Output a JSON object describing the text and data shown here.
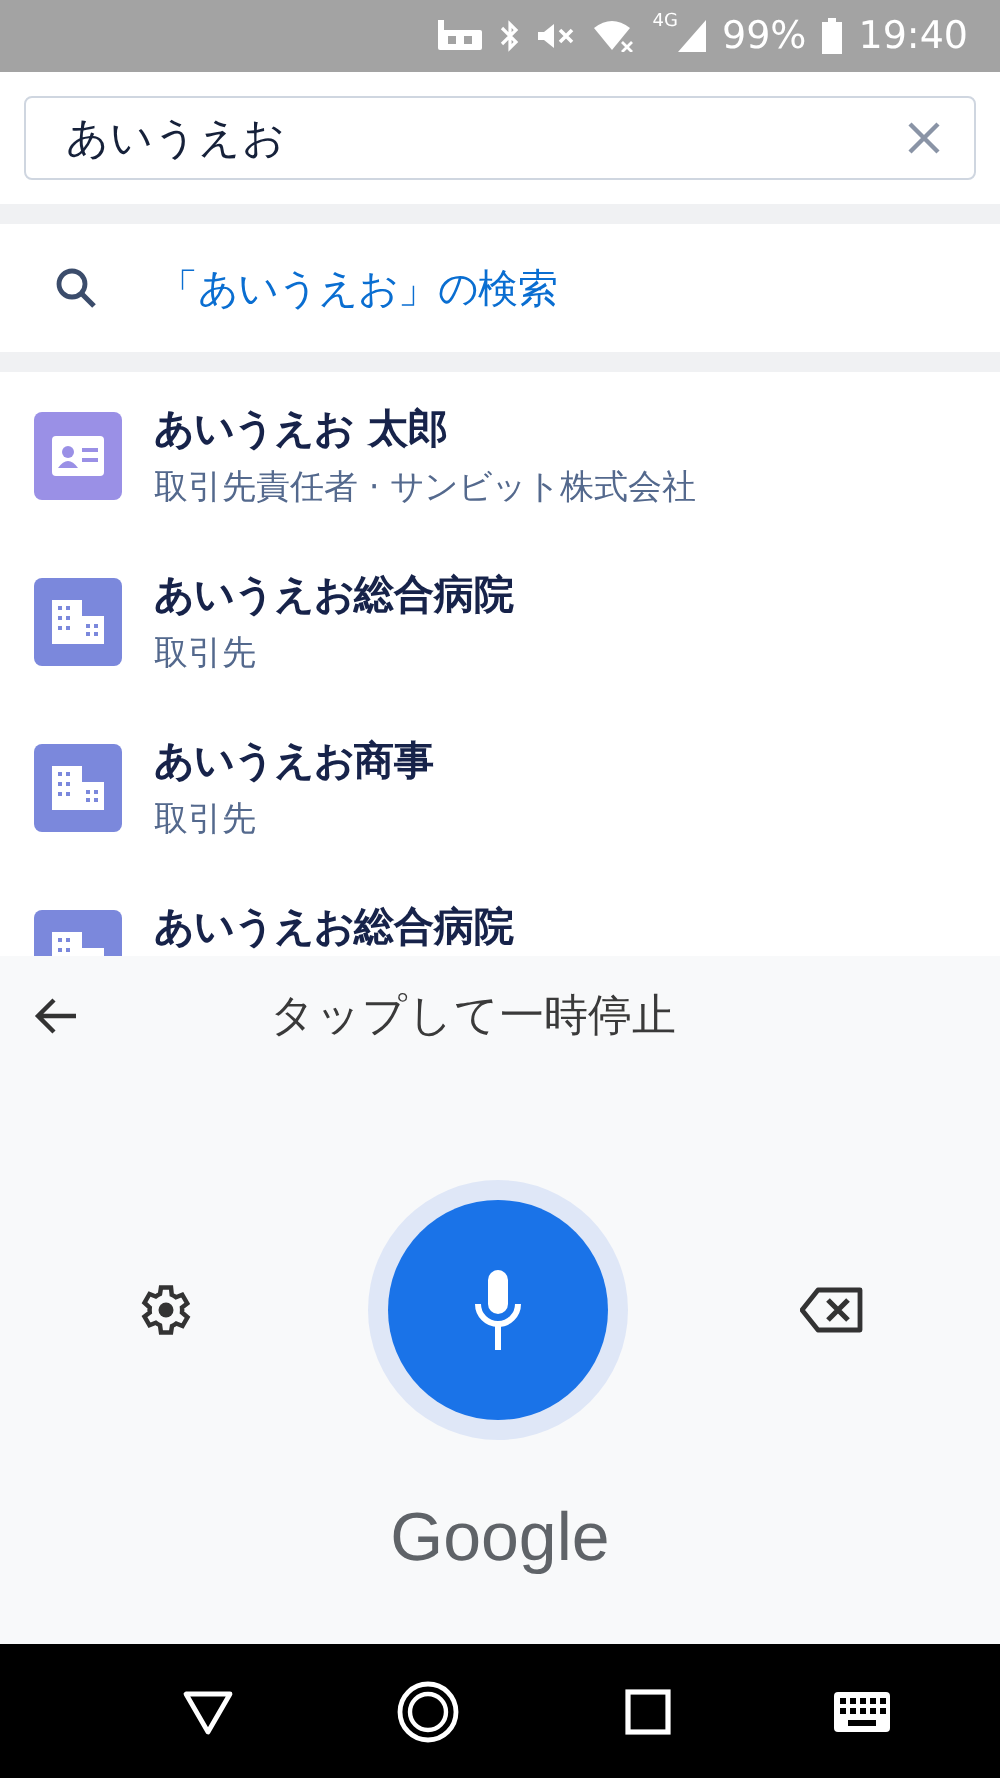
{
  "status_bar": {
    "network_label": "4G",
    "battery": "99%",
    "time": "19:40"
  },
  "search": {
    "value": "あいうえお"
  },
  "suggestion": {
    "text": "「あいうえお」の検索"
  },
  "results": [
    {
      "kind": "contact",
      "title": "あいうえお 太郎",
      "subtitle": "取引先責任者 · サンビット株式会社"
    },
    {
      "kind": "account",
      "title": "あいうえお総合病院",
      "subtitle": "取引先"
    },
    {
      "kind": "account",
      "title": "あいうえお商事",
      "subtitle": "取引先"
    },
    {
      "kind": "account",
      "title": "あいうえお総合病院"
    }
  ],
  "voice_panel": {
    "prompt": "タップして一時停止",
    "brand": "Google"
  }
}
